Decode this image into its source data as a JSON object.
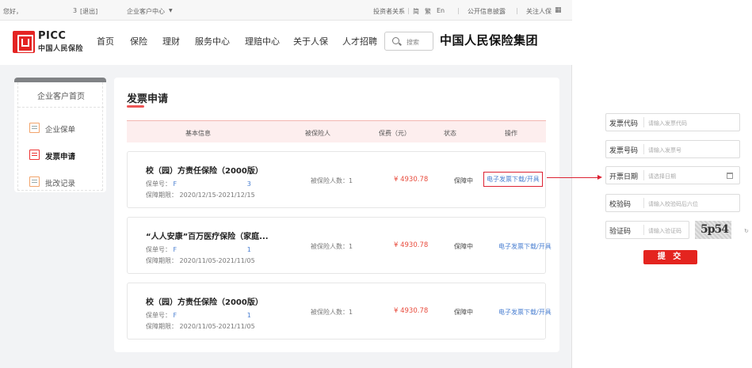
{
  "topbar": {
    "greeting": "您好，",
    "user_suffix": "3",
    "logout": "[退出]",
    "enterprise_center": "企业客户中心",
    "investor_relations": "投资者关系",
    "lang_simplified": "简",
    "lang_traditional": "繁",
    "lang_english": "En",
    "public_info": "公开信息披露",
    "follow": "关注人保"
  },
  "header": {
    "logo_en": "PICC",
    "logo_cn": "中国人民保险",
    "nav": [
      "首页",
      "保险",
      "理财",
      "服务中心",
      "理赔中心",
      "关于人保",
      "人才招聘"
    ],
    "search_label": "搜索",
    "group_name": "中国人民保险集团"
  },
  "sidebar": {
    "home": "企业客户首页",
    "items": [
      {
        "label": "企业保单",
        "icon": "policy-icon"
      },
      {
        "label": "发票申请",
        "icon": "invoice-icon"
      },
      {
        "label": "批改记录",
        "icon": "record-icon"
      }
    ]
  },
  "content": {
    "title": "发票申请",
    "columns": [
      "基本信息",
      "被保险人",
      "保费（元）",
      "状态",
      "操作"
    ],
    "rows": [
      {
        "product": "校（园）方责任保险（2000版）",
        "policy_label": "保单号：",
        "policy_no_start": "F",
        "policy_no_end": "3",
        "period_label": "保障期限：",
        "period": "2020/12/15-2021/12/15",
        "insured": "被保险人数：1",
        "premium": "¥ 4930.78",
        "status": "保障中",
        "action": "电子发票下载/开具"
      },
      {
        "product": "“人人安康”百万医疗保险（家庭...",
        "policy_label": "保单号：",
        "policy_no_start": "F",
        "policy_no_end": "1",
        "period_label": "保障期限：",
        "period": "2020/11/05-2021/11/05",
        "insured": "被保险人数：1",
        "premium": "¥ 4930.78",
        "status": "保障中",
        "action": "电子发票下载/开具"
      },
      {
        "product": "校（园）方责任保险（2000版）",
        "policy_label": "保单号：",
        "policy_no_start": "F",
        "policy_no_end": "1",
        "period_label": "保障期限：",
        "period": "2020/11/05-2021/11/05",
        "insured": "被保险人数：1",
        "premium": "¥ 4930.78",
        "status": "保障中",
        "action": "电子发票下载/开具"
      }
    ]
  },
  "invoice_form": {
    "fields": [
      {
        "label": "发票代码",
        "placeholder": "请输入发票代码"
      },
      {
        "label": "发票号码",
        "placeholder": "请输入发票号"
      },
      {
        "label": "开票日期",
        "placeholder": "请选择日期"
      },
      {
        "label": "校验码",
        "placeholder": "请输入校验码后六位"
      },
      {
        "label": "验证码",
        "placeholder": "请输入验证码"
      }
    ],
    "captcha_text": "5p54",
    "submit": "提 交"
  },
  "colors": {
    "brand_red": "#e42423",
    "link_blue": "#4a7fd1",
    "price_red": "#e84b3c"
  }
}
